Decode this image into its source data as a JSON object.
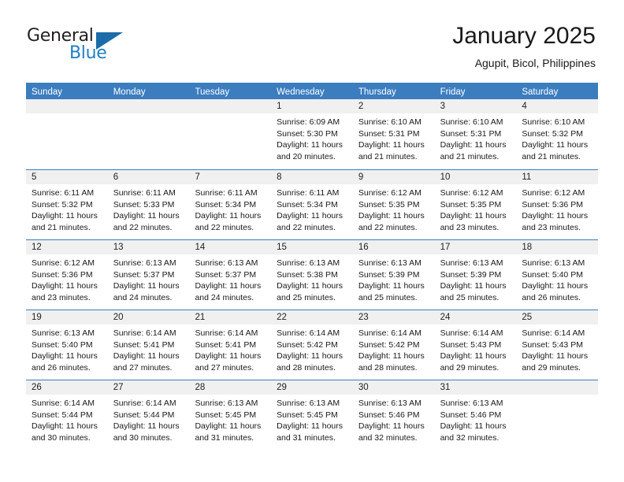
{
  "brand": {
    "name_top": "General",
    "name_bottom": "Blue",
    "accent_color": "#1b6ca8",
    "triangle_icon": "triangle-icon"
  },
  "header": {
    "title": "January 2025",
    "subtitle": "Agupit, Bicol, Philippines"
  },
  "calendar": {
    "header_bg": "#3b7dbf",
    "daynum_bg": "#f0f0f0",
    "weekdays": [
      "Sunday",
      "Monday",
      "Tuesday",
      "Wednesday",
      "Thursday",
      "Friday",
      "Saturday"
    ],
    "weeks": [
      [
        {
          "day": "",
          "empty": true,
          "lines": []
        },
        {
          "day": "",
          "empty": true,
          "lines": []
        },
        {
          "day": "",
          "empty": true,
          "lines": []
        },
        {
          "day": "1",
          "empty": false,
          "lines": [
            "Sunrise: 6:09 AM",
            "Sunset: 5:30 PM",
            "Daylight: 11 hours",
            "and 20 minutes."
          ]
        },
        {
          "day": "2",
          "empty": false,
          "lines": [
            "Sunrise: 6:10 AM",
            "Sunset: 5:31 PM",
            "Daylight: 11 hours",
            "and 21 minutes."
          ]
        },
        {
          "day": "3",
          "empty": false,
          "lines": [
            "Sunrise: 6:10 AM",
            "Sunset: 5:31 PM",
            "Daylight: 11 hours",
            "and 21 minutes."
          ]
        },
        {
          "day": "4",
          "empty": false,
          "lines": [
            "Sunrise: 6:10 AM",
            "Sunset: 5:32 PM",
            "Daylight: 11 hours",
            "and 21 minutes."
          ]
        }
      ],
      [
        {
          "day": "5",
          "empty": false,
          "lines": [
            "Sunrise: 6:11 AM",
            "Sunset: 5:32 PM",
            "Daylight: 11 hours",
            "and 21 minutes."
          ]
        },
        {
          "day": "6",
          "empty": false,
          "lines": [
            "Sunrise: 6:11 AM",
            "Sunset: 5:33 PM",
            "Daylight: 11 hours",
            "and 22 minutes."
          ]
        },
        {
          "day": "7",
          "empty": false,
          "lines": [
            "Sunrise: 6:11 AM",
            "Sunset: 5:34 PM",
            "Daylight: 11 hours",
            "and 22 minutes."
          ]
        },
        {
          "day": "8",
          "empty": false,
          "lines": [
            "Sunrise: 6:11 AM",
            "Sunset: 5:34 PM",
            "Daylight: 11 hours",
            "and 22 minutes."
          ]
        },
        {
          "day": "9",
          "empty": false,
          "lines": [
            "Sunrise: 6:12 AM",
            "Sunset: 5:35 PM",
            "Daylight: 11 hours",
            "and 22 minutes."
          ]
        },
        {
          "day": "10",
          "empty": false,
          "lines": [
            "Sunrise: 6:12 AM",
            "Sunset: 5:35 PM",
            "Daylight: 11 hours",
            "and 23 minutes."
          ]
        },
        {
          "day": "11",
          "empty": false,
          "lines": [
            "Sunrise: 6:12 AM",
            "Sunset: 5:36 PM",
            "Daylight: 11 hours",
            "and 23 minutes."
          ]
        }
      ],
      [
        {
          "day": "12",
          "empty": false,
          "lines": [
            "Sunrise: 6:12 AM",
            "Sunset: 5:36 PM",
            "Daylight: 11 hours",
            "and 23 minutes."
          ]
        },
        {
          "day": "13",
          "empty": false,
          "lines": [
            "Sunrise: 6:13 AM",
            "Sunset: 5:37 PM",
            "Daylight: 11 hours",
            "and 24 minutes."
          ]
        },
        {
          "day": "14",
          "empty": false,
          "lines": [
            "Sunrise: 6:13 AM",
            "Sunset: 5:37 PM",
            "Daylight: 11 hours",
            "and 24 minutes."
          ]
        },
        {
          "day": "15",
          "empty": false,
          "lines": [
            "Sunrise: 6:13 AM",
            "Sunset: 5:38 PM",
            "Daylight: 11 hours",
            "and 25 minutes."
          ]
        },
        {
          "day": "16",
          "empty": false,
          "lines": [
            "Sunrise: 6:13 AM",
            "Sunset: 5:39 PM",
            "Daylight: 11 hours",
            "and 25 minutes."
          ]
        },
        {
          "day": "17",
          "empty": false,
          "lines": [
            "Sunrise: 6:13 AM",
            "Sunset: 5:39 PM",
            "Daylight: 11 hours",
            "and 25 minutes."
          ]
        },
        {
          "day": "18",
          "empty": false,
          "lines": [
            "Sunrise: 6:13 AM",
            "Sunset: 5:40 PM",
            "Daylight: 11 hours",
            "and 26 minutes."
          ]
        }
      ],
      [
        {
          "day": "19",
          "empty": false,
          "lines": [
            "Sunrise: 6:13 AM",
            "Sunset: 5:40 PM",
            "Daylight: 11 hours",
            "and 26 minutes."
          ]
        },
        {
          "day": "20",
          "empty": false,
          "lines": [
            "Sunrise: 6:14 AM",
            "Sunset: 5:41 PM",
            "Daylight: 11 hours",
            "and 27 minutes."
          ]
        },
        {
          "day": "21",
          "empty": false,
          "lines": [
            "Sunrise: 6:14 AM",
            "Sunset: 5:41 PM",
            "Daylight: 11 hours",
            "and 27 minutes."
          ]
        },
        {
          "day": "22",
          "empty": false,
          "lines": [
            "Sunrise: 6:14 AM",
            "Sunset: 5:42 PM",
            "Daylight: 11 hours",
            "and 28 minutes."
          ]
        },
        {
          "day": "23",
          "empty": false,
          "lines": [
            "Sunrise: 6:14 AM",
            "Sunset: 5:42 PM",
            "Daylight: 11 hours",
            "and 28 minutes."
          ]
        },
        {
          "day": "24",
          "empty": false,
          "lines": [
            "Sunrise: 6:14 AM",
            "Sunset: 5:43 PM",
            "Daylight: 11 hours",
            "and 29 minutes."
          ]
        },
        {
          "day": "25",
          "empty": false,
          "lines": [
            "Sunrise: 6:14 AM",
            "Sunset: 5:43 PM",
            "Daylight: 11 hours",
            "and 29 minutes."
          ]
        }
      ],
      [
        {
          "day": "26",
          "empty": false,
          "lines": [
            "Sunrise: 6:14 AM",
            "Sunset: 5:44 PM",
            "Daylight: 11 hours",
            "and 30 minutes."
          ]
        },
        {
          "day": "27",
          "empty": false,
          "lines": [
            "Sunrise: 6:14 AM",
            "Sunset: 5:44 PM",
            "Daylight: 11 hours",
            "and 30 minutes."
          ]
        },
        {
          "day": "28",
          "empty": false,
          "lines": [
            "Sunrise: 6:13 AM",
            "Sunset: 5:45 PM",
            "Daylight: 11 hours",
            "and 31 minutes."
          ]
        },
        {
          "day": "29",
          "empty": false,
          "lines": [
            "Sunrise: 6:13 AM",
            "Sunset: 5:45 PM",
            "Daylight: 11 hours",
            "and 31 minutes."
          ]
        },
        {
          "day": "30",
          "empty": false,
          "lines": [
            "Sunrise: 6:13 AM",
            "Sunset: 5:46 PM",
            "Daylight: 11 hours",
            "and 32 minutes."
          ]
        },
        {
          "day": "31",
          "empty": false,
          "lines": [
            "Sunrise: 6:13 AM",
            "Sunset: 5:46 PM",
            "Daylight: 11 hours",
            "and 32 minutes."
          ]
        },
        {
          "day": "",
          "empty": true,
          "lines": []
        }
      ]
    ]
  }
}
